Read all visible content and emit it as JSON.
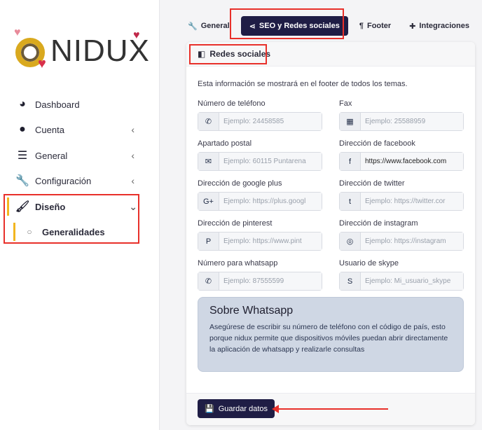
{
  "brand": {
    "name": "NIDUX",
    "accent": "#1f1d45",
    "highlight": "#e8302a",
    "active_bar": "#f2b61f"
  },
  "sidebar": {
    "items": [
      {
        "label": "Dashboard",
        "icon": "tachometer-icon"
      },
      {
        "label": "Cuenta",
        "icon": "user-circle-icon"
      },
      {
        "label": "General",
        "icon": "sliders-icon"
      },
      {
        "label": "Configuración",
        "icon": "wrench-icon"
      },
      {
        "label": "Diseño",
        "icon": "paint-brush-icon"
      },
      {
        "label": "Generalidades",
        "icon": "circle-icon"
      }
    ]
  },
  "tabs": [
    {
      "label": "General"
    },
    {
      "label": "SEO y Redes sociales"
    },
    {
      "label": "Footer"
    },
    {
      "label": "Integraciones"
    }
  ],
  "card": {
    "title": "Redes sociales",
    "intro": "Esta información se mostrará en el footer de todos los temas.",
    "fields": [
      {
        "label": "Número de teléfono",
        "placeholder": "Ejemplo: 24458585",
        "value": ""
      },
      {
        "label": "Fax",
        "placeholder": "Ejemplo: 25588959",
        "value": ""
      },
      {
        "label": "Apartado postal",
        "placeholder": "Ejemplo: 60115 Puntarena",
        "value": ""
      },
      {
        "label": "Dirección de facebook",
        "placeholder": "",
        "value": "https://www.facebook.com"
      },
      {
        "label": "Dirección de google plus",
        "placeholder": "Ejemplo: https://plus.googl",
        "value": ""
      },
      {
        "label": "Dirección de twitter",
        "placeholder": "Ejemplo: https://twitter.cor",
        "value": ""
      },
      {
        "label": "Dirección de pinterest",
        "placeholder": "Ejemplo: https://www.pint",
        "value": ""
      },
      {
        "label": "Dirección de instagram",
        "placeholder": "Ejemplo: https://instagram",
        "value": ""
      },
      {
        "label": "Número para whatsapp",
        "placeholder": "Ejemplo: 87555599",
        "value": ""
      },
      {
        "label": "Usuario de skype",
        "placeholder": "Ejemplo: Mi_usuario_skype",
        "value": ""
      }
    ],
    "info": {
      "title": "Sobre Whatsapp",
      "text": "Asegúrese de escribir su número de teléfono con el código de país, esto porque nidux permite que dispositivos móviles puedan abrir directamente la aplicación de whatsapp y realizarle consultas"
    },
    "save_label": "Guardar datos"
  }
}
